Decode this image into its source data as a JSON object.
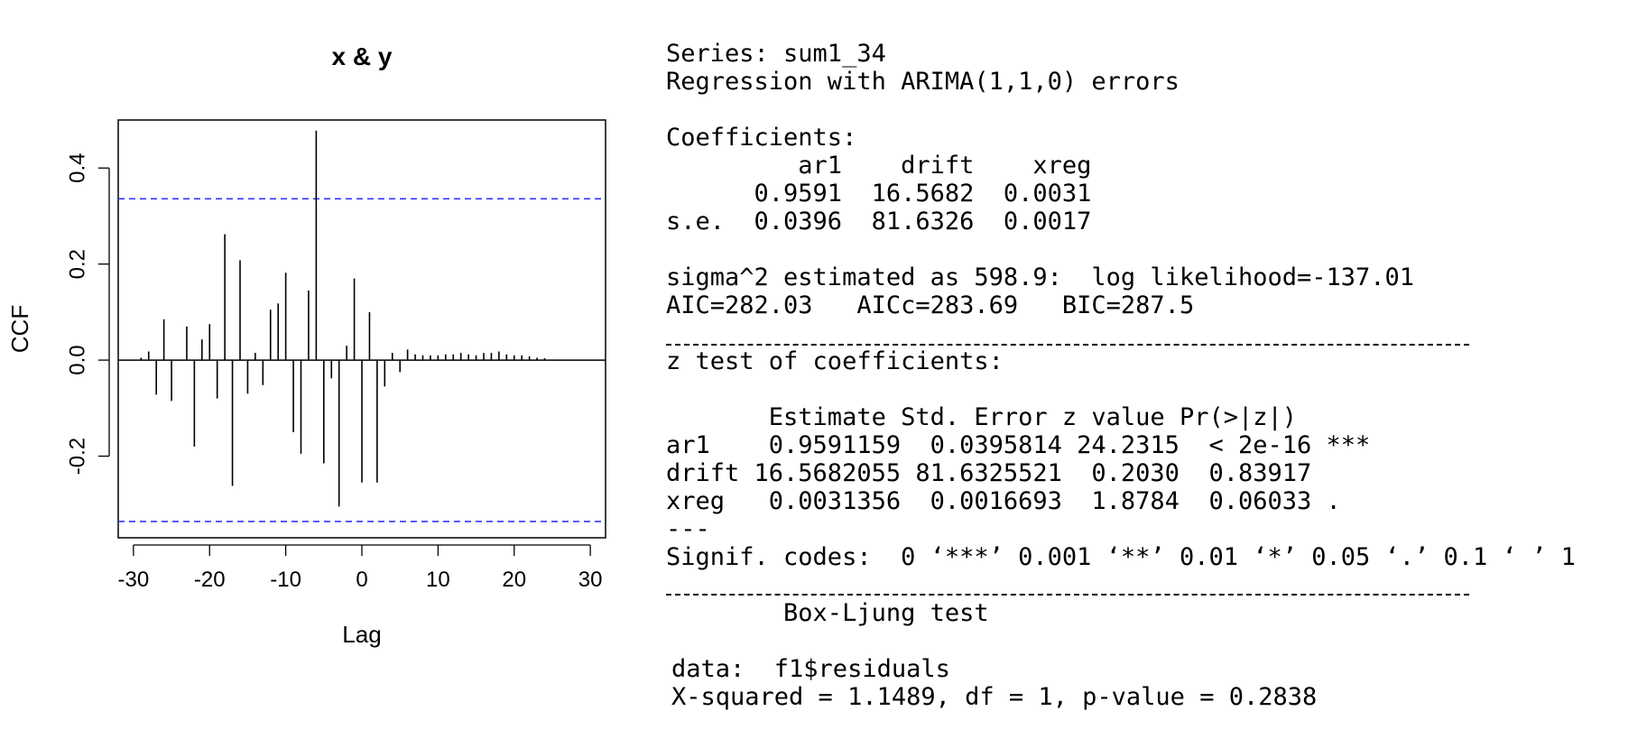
{
  "chart_data": {
    "type": "bar",
    "title": "x & y",
    "xlabel": "Lag",
    "ylabel": "CCF",
    "xlim": [
      -32,
      32
    ],
    "ylim": [
      -0.37,
      0.5
    ],
    "x_ticks": [
      -30,
      -20,
      -10,
      0,
      10,
      20,
      30
    ],
    "x_tick_labels": [
      "-30",
      "-20",
      "-10",
      "0",
      "10",
      "20",
      "30"
    ],
    "y_ticks": [
      -0.2,
      0.0,
      0.2,
      0.4
    ],
    "y_tick_labels": [
      "-0.2",
      "0.0",
      "0.2",
      "0.4"
    ],
    "confidence_bounds": [
      0.336,
      -0.336
    ],
    "bound_color": "#3333ff",
    "bar_color": "#000000",
    "lags": [
      -30,
      -29,
      -28,
      -27,
      -26,
      -25,
      -24,
      -23,
      -22,
      -21,
      -20,
      -19,
      -18,
      -17,
      -16,
      -15,
      -14,
      -13,
      -12,
      -11,
      -10,
      -9,
      -8,
      -7,
      -6,
      -5,
      -4,
      -3,
      -2,
      -1,
      0,
      1,
      2,
      3,
      4,
      5,
      6,
      7,
      8,
      9,
      10,
      11,
      12,
      13,
      14,
      15,
      16,
      17,
      18,
      19,
      20,
      21,
      22,
      23,
      24
    ],
    "values": [
      0.0,
      0.005,
      0.018,
      -0.072,
      0.085,
      -0.085,
      0.0,
      0.07,
      -0.18,
      0.043,
      0.075,
      -0.08,
      0.262,
      -0.262,
      0.208,
      -0.07,
      0.015,
      -0.052,
      0.105,
      0.118,
      0.182,
      -0.15,
      -0.195,
      0.145,
      0.478,
      -0.215,
      -0.038,
      -0.305,
      0.03,
      0.17,
      -0.255,
      0.1,
      -0.255,
      -0.055,
      0.015,
      -0.025,
      0.022,
      0.012,
      0.01,
      0.01,
      0.01,
      0.012,
      0.012,
      0.015,
      0.012,
      0.01,
      0.015,
      0.015,
      0.018,
      0.012,
      0.01,
      0.01,
      0.008,
      0.005,
      0.004
    ]
  },
  "console": {
    "l1": "Series: sum1_34",
    "l2": "Regression with ARIMA(1,1,0) errors",
    "l3": "Coefficients:",
    "l4": "         ar1    drift    xreg",
    "l5": "      0.9591  16.5682  0.0031",
    "l6": "s.e.  0.0396  81.6326  0.0017",
    "l7": "sigma^2 estimated as 598.9:  log likelihood=-137.01",
    "l8": "AIC=282.03   AICc=283.69   BIC=287.5",
    "l9": "z test of coefficients:",
    "l10": "       Estimate Std. Error z value Pr(>|z|)",
    "l11": "ar1    0.9591159  0.0395814 24.2315  < 2e-16 ***",
    "l12": "drift 16.5682055 81.6325521  0.2030  0.83917",
    "l13": "xreg   0.0031356  0.0016693  1.8784  0.06033 .",
    "l14": "---",
    "l15": "Signif. codes:  0 ‘***’ 0.001 ‘**’ 0.01 ‘*’ 0.05 ‘.’ 0.1 ‘ ’ 1",
    "l16": "        Box-Ljung test",
    "l17": "data:  f1$residuals",
    "l18": "X-squared = 1.1489, df = 1, p-value = 0.2838"
  }
}
